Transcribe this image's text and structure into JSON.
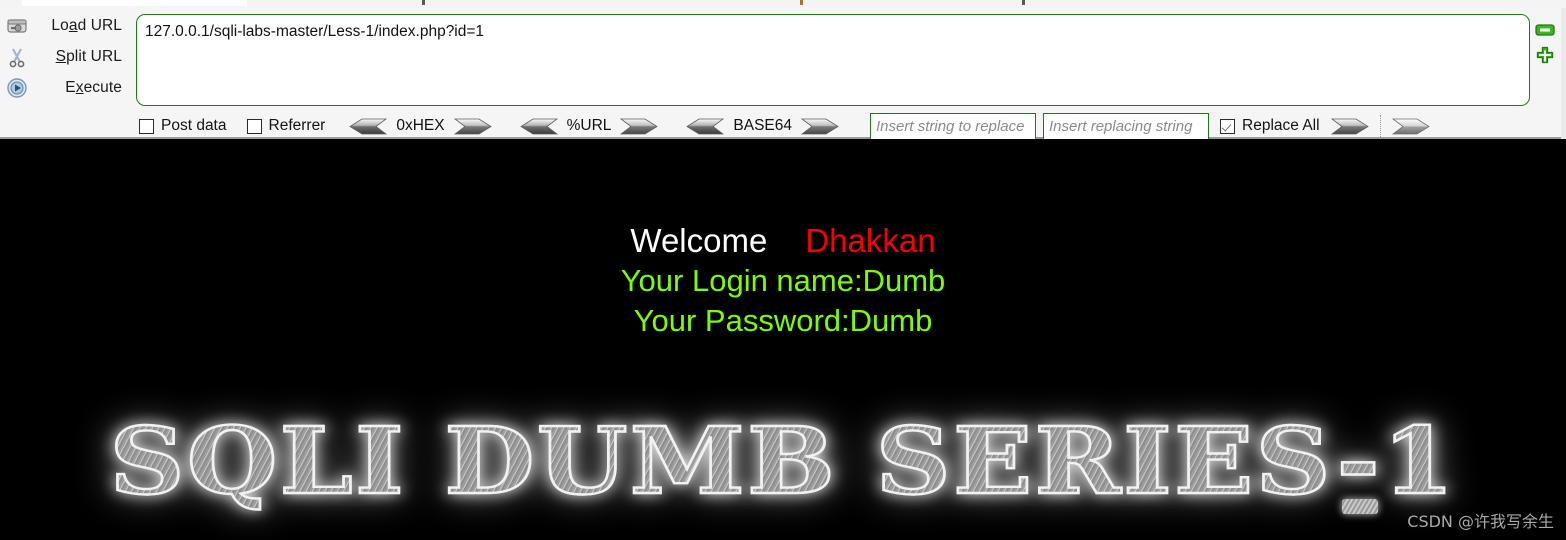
{
  "toolbar": {
    "actions": [
      {
        "label_pre": "Lo",
        "label_mnemonic": "a",
        "label_post": "d URL",
        "icon": "load-url-icon"
      },
      {
        "label_pre": "",
        "label_mnemonic": "S",
        "label_post": "plit URL",
        "icon": "split-url-scissors-icon"
      },
      {
        "label_pre": "E",
        "label_mnemonic": "x",
        "label_post": "ecute",
        "icon": "execute-play-icon"
      }
    ],
    "url_value": "127.0.0.1/sqli-labs-master/Less-1/index.php?id=1",
    "post_data_label": "Post data",
    "post_data_checked": false,
    "referrer_label": "Referrer",
    "referrer_checked": false,
    "encoders": [
      {
        "label": "0xHEX"
      },
      {
        "label": "%URL"
      },
      {
        "label": "BASE64"
      }
    ],
    "search_placeholder": "Insert string to replace",
    "search_value": "",
    "replace_placeholder": "Insert replacing string",
    "replace_value": "",
    "replace_all_label": "Replace All",
    "replace_all_checked": true,
    "minus_icon": "minus-icon",
    "plus_icon": "plus-icon",
    "accent_green": "#1a7a17",
    "icon_green": "#3cb521"
  },
  "page": {
    "welcome_word": "Welcome",
    "welcome_name": "Dhakkan",
    "login_line": "Your Login name:Dumb",
    "password_line": "Your Password:Dumb",
    "logo_text": "SQLI DUMB SERIES-1",
    "watermark": "CSDN @许我写余生 ",
    "background": "#000000",
    "welcome_color": "#ffffff",
    "name_color": "#f70000",
    "credentials_color": "#7cfc00"
  }
}
